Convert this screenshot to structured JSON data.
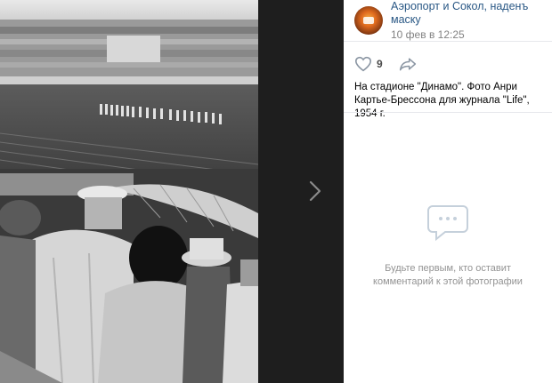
{
  "post": {
    "group_name": "Аэропорт и Сокол, наденъ маску",
    "date": "10 фев в 12:25",
    "likes": "9",
    "caption": "На стадионе \"Динамо\". Фото Анри Картье-Брессона для журнала \"Life\", 1954 г."
  },
  "comments": {
    "empty_line1": "Будьте первым, кто оставит",
    "empty_line2": "комментарий к этой фотографии"
  },
  "icons": {
    "next": "chevron-right-icon",
    "like": "heart-icon",
    "share": "share-arrow-icon",
    "comments": "speech-bubble-icon"
  }
}
